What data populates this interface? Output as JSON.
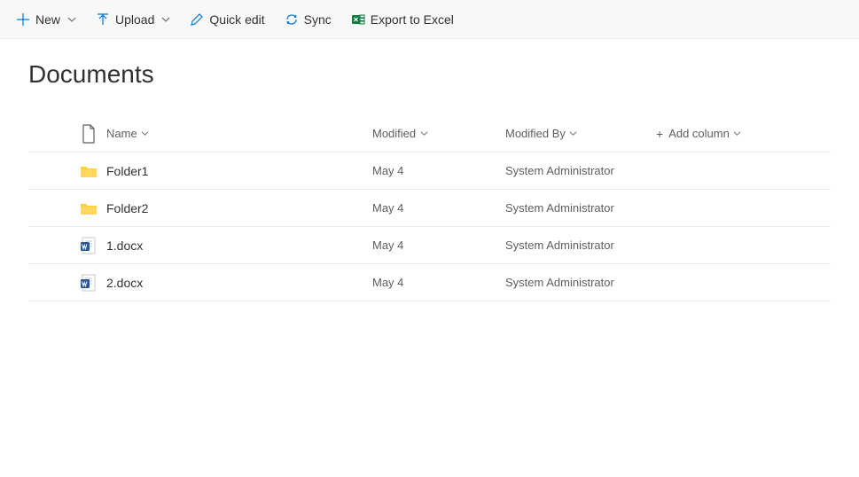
{
  "toolbar": {
    "new_label": "New",
    "upload_label": "Upload",
    "quickedit_label": "Quick edit",
    "sync_label": "Sync",
    "export_label": "Export to Excel"
  },
  "page": {
    "title": "Documents"
  },
  "columns": {
    "name_label": "Name",
    "modified_label": "Modified",
    "modifiedby_label": "Modified By",
    "addcolumn_label": "Add column"
  },
  "rows": [
    {
      "type": "folder",
      "name": "Folder1",
      "modified": "May 4",
      "modifiedBy": "System Administrator"
    },
    {
      "type": "folder",
      "name": "Folder2",
      "modified": "May 4",
      "modifiedBy": "System Administrator"
    },
    {
      "type": "docx",
      "name": "1.docx",
      "modified": "May 4",
      "modifiedBy": "System Administrator"
    },
    {
      "type": "docx",
      "name": "2.docx",
      "modified": "May 4",
      "modifiedBy": "System Administrator"
    }
  ]
}
